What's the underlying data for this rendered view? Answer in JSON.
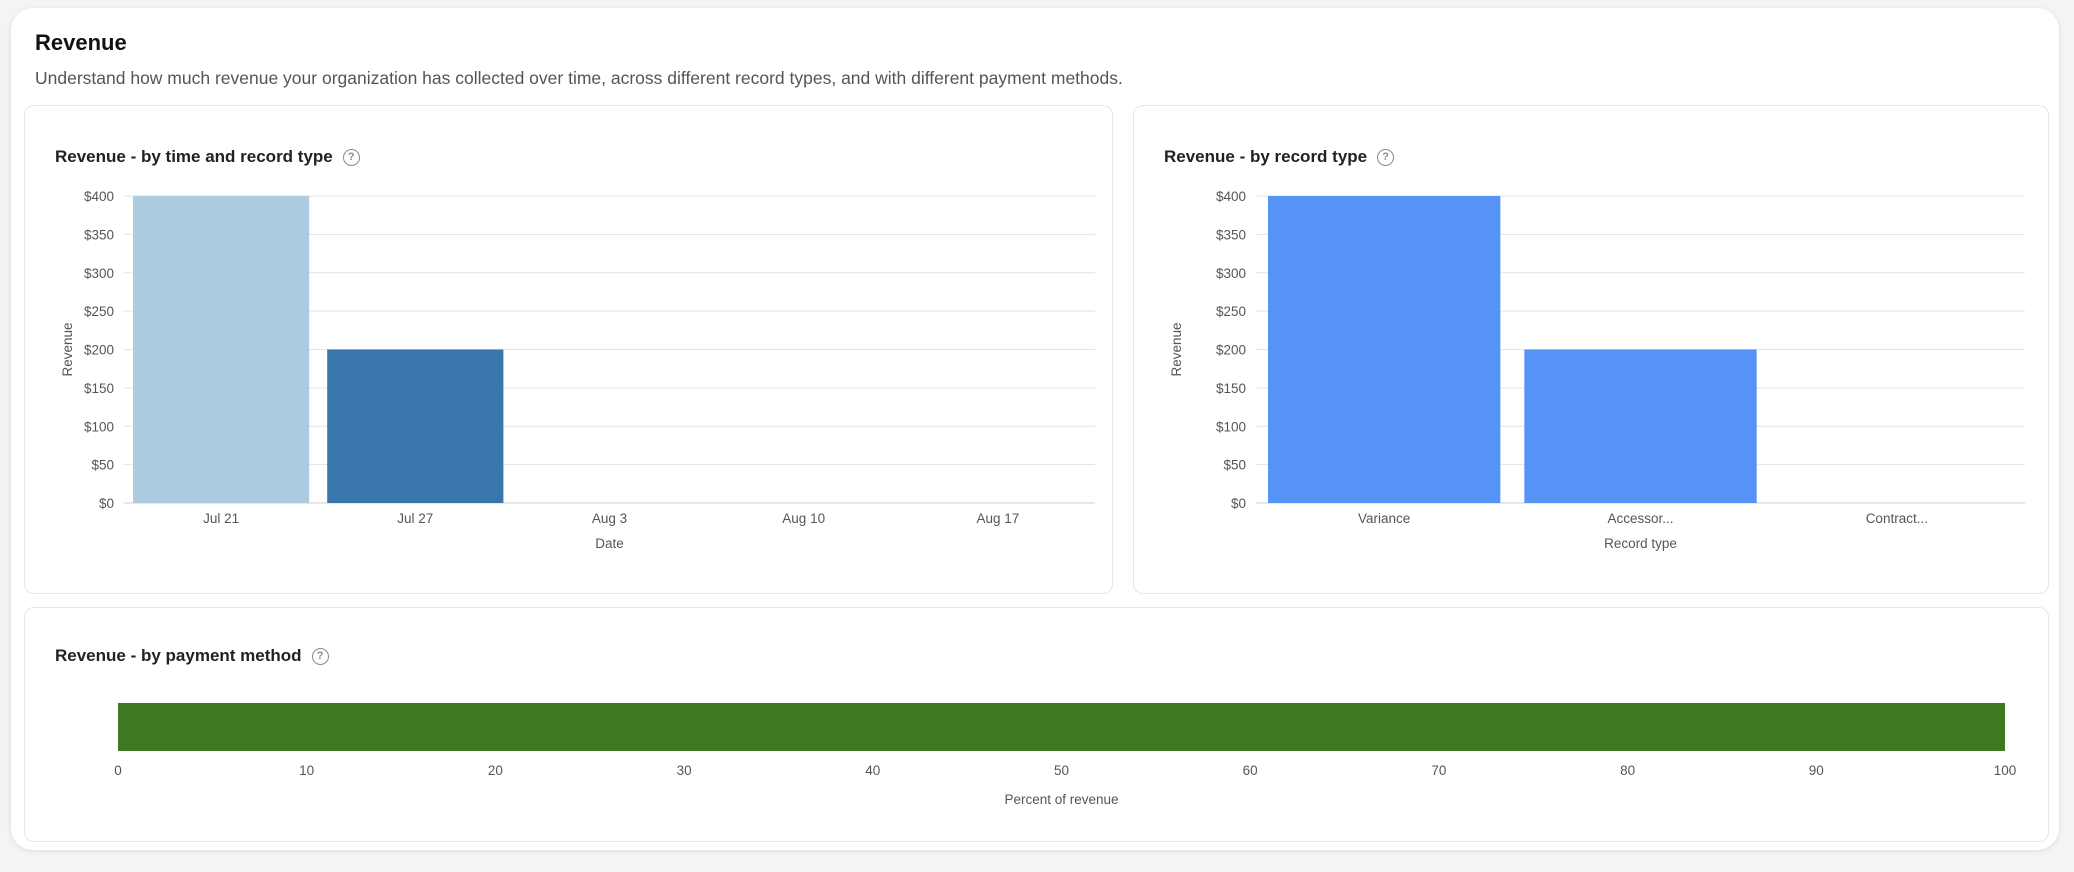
{
  "header": {
    "title": "Revenue",
    "subtitle": "Understand how much revenue your organization has collected over time, across different record types, and with different payment methods."
  },
  "chart_data": [
    {
      "id": "time",
      "type": "bar",
      "title": "Revenue - by time and record type",
      "xlabel": "Date",
      "ylabel": "Revenue",
      "categories": [
        "Jul 21",
        "Jul 27",
        "Aug 3",
        "Aug 10",
        "Aug 17"
      ],
      "values": [
        400,
        200,
        0,
        0,
        0
      ],
      "colors": [
        "#aecce1",
        "#3a75ae",
        "#3a75ae",
        "#3a75ae",
        "#3a75ae"
      ],
      "ylim": [
        0,
        400
      ],
      "yticks": [
        0,
        50,
        100,
        150,
        200,
        250,
        300,
        350,
        400
      ],
      "ytick_labels": [
        "$0",
        "$50",
        "$100",
        "$150",
        "$200",
        "$250",
        "$300",
        "$350",
        "$400"
      ],
      "grid": true
    },
    {
      "id": "type",
      "type": "bar",
      "title": "Revenue - by record type",
      "xlabel": "Record type",
      "ylabel": "Revenue",
      "categories": [
        "Variance",
        "Accessor...",
        "Contract..."
      ],
      "values": [
        400,
        200,
        0
      ],
      "colors": [
        "#5593f7",
        "#5593f7",
        "#5593f7"
      ],
      "ylim": [
        0,
        400
      ],
      "yticks": [
        0,
        50,
        100,
        150,
        200,
        250,
        300,
        350,
        400
      ],
      "ytick_labels": [
        "$0",
        "$50",
        "$100",
        "$150",
        "$200",
        "$250",
        "$300",
        "$350",
        "$400"
      ],
      "grid": true
    },
    {
      "id": "payment",
      "type": "bar",
      "orientation": "horizontal",
      "title": "Revenue - by payment method",
      "xlabel": "Percent of revenue",
      "values": [
        100
      ],
      "colors": [
        "#3d7a22"
      ],
      "xlim": [
        0,
        100
      ],
      "xticks": [
        0,
        10,
        20,
        30,
        40,
        50,
        60,
        70,
        80,
        90,
        100
      ],
      "xtick_labels": [
        "0",
        "10",
        "20",
        "30",
        "40",
        "50",
        "60",
        "70",
        "80",
        "90",
        "100"
      ],
      "grid": false
    }
  ]
}
